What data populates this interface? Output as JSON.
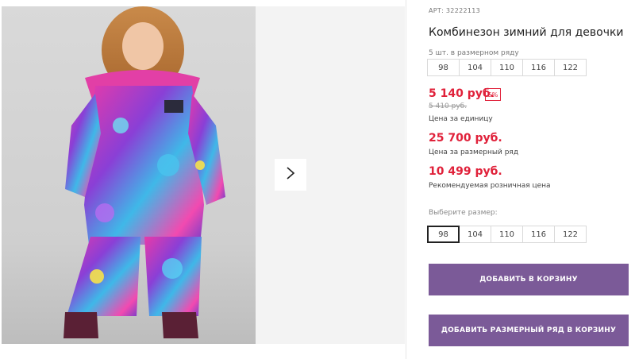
{
  "product": {
    "sku": "АРТ: 32222113",
    "title": "Комбинезон зимний для девочки",
    "row_note": "5 шт. в размерном ряду",
    "sizes_in_row": [
      "98",
      "104",
      "110",
      "116",
      "122"
    ],
    "price_unit": "5 140 руб.",
    "discount_badge": "5%",
    "old_price": "5 410 руб.",
    "price_unit_caption": "Цена за единицу",
    "price_row": "25 700 руб.",
    "price_row_caption": "Цена за размерный ряд",
    "price_retail": "10 499 руб.",
    "price_retail_caption": "Рекомендуемая розничная цена"
  },
  "size_selector": {
    "label": "Выберите размер:",
    "options": [
      "98",
      "104",
      "110",
      "116",
      "122"
    ],
    "selected": "98"
  },
  "actions": {
    "add_to_cart": "ДОБАВИТЬ В КОРЗИНУ",
    "add_row_to_cart": "ДОБАВИТЬ РАЗМЕРНЫЙ РЯД В КОРЗИНУ"
  },
  "colors": {
    "price_red": "#e0213a",
    "button_purple": "#7b5a98"
  },
  "icons": {
    "next": "chevron-right-icon"
  }
}
